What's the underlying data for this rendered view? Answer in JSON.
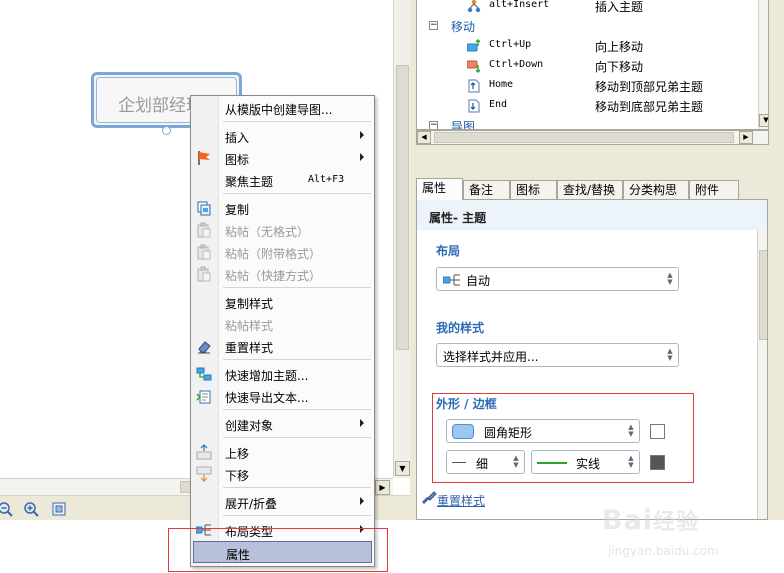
{
  "canvas": {
    "topic_text": "企划部经理"
  },
  "command_list": {
    "rows": [
      {
        "type": "command",
        "icon": "insert-topic-icon",
        "key": "alt+Insert",
        "desc": "插入主题"
      },
      {
        "type": "group",
        "toggle": "−",
        "name": "移动"
      },
      {
        "type": "command",
        "icon": "move-up-icon",
        "key": "Ctrl+Up",
        "desc": "向上移动"
      },
      {
        "type": "command",
        "icon": "move-down-icon",
        "key": "Ctrl+Down",
        "desc": "向下移动"
      },
      {
        "type": "command",
        "icon": "move-top-icon",
        "key": "Home",
        "desc": "移动到顶部兄弟主题"
      },
      {
        "type": "command",
        "icon": "move-bottom-icon",
        "key": "End",
        "desc": "移动到底部兄弟主题"
      },
      {
        "type": "group",
        "toggle": "−",
        "name": "导图"
      }
    ]
  },
  "tabs": [
    {
      "label": "属性",
      "active": true
    },
    {
      "label": "备注",
      "active": false
    },
    {
      "label": "图标",
      "active": false
    },
    {
      "label": "查找/替换",
      "active": false
    },
    {
      "label": "分类构思",
      "active": false
    },
    {
      "label": "附件",
      "active": false
    }
  ],
  "properties": {
    "title": "属性- 主题",
    "layout": {
      "section": "布局",
      "value": "自动"
    },
    "my_style": {
      "section": "我的样式",
      "value": "选择样式并应用..."
    },
    "shape": {
      "section": "外形 / 边框",
      "shape_value": "圆角矩形",
      "line_weight": "细",
      "line_style": "实线",
      "fill_color": "#ffffff",
      "line_color": "#555555"
    },
    "reset_link": "重置样式"
  },
  "context_menu": {
    "items": [
      {
        "label": "从模版中创建导图...",
        "icon": "",
        "disabled": false,
        "submenu": false,
        "shortcut": ""
      },
      {
        "sep": true
      },
      {
        "label": "插入",
        "icon": "",
        "disabled": false,
        "submenu": true,
        "shortcut": ""
      },
      {
        "label": "图标",
        "icon": "flag-icon",
        "disabled": false,
        "submenu": true,
        "shortcut": ""
      },
      {
        "label": "聚焦主题",
        "icon": "",
        "disabled": false,
        "submenu": false,
        "shortcut": "Alt+F3"
      },
      {
        "sep": true
      },
      {
        "label": "复制",
        "icon": "copy-icon",
        "disabled": false,
        "submenu": false,
        "shortcut": ""
      },
      {
        "label": "粘帖（无格式）",
        "icon": "paste-icon",
        "disabled": true,
        "submenu": false,
        "shortcut": ""
      },
      {
        "label": "粘帖（附带格式）",
        "icon": "paste-icon",
        "disabled": true,
        "submenu": false,
        "shortcut": ""
      },
      {
        "label": "粘帖（快捷方式）",
        "icon": "paste-icon",
        "disabled": true,
        "submenu": false,
        "shortcut": ""
      },
      {
        "sep": true
      },
      {
        "label": "复制样式",
        "icon": "",
        "disabled": false,
        "submenu": false,
        "shortcut": ""
      },
      {
        "label": "粘帖样式",
        "icon": "",
        "disabled": true,
        "submenu": false,
        "shortcut": ""
      },
      {
        "label": "重置样式",
        "icon": "eraser-icon",
        "disabled": false,
        "submenu": false,
        "shortcut": ""
      },
      {
        "sep": true
      },
      {
        "label": "快速增加主题...",
        "icon": "quick-add-icon",
        "disabled": false,
        "submenu": false,
        "shortcut": ""
      },
      {
        "label": "快速导出文本...",
        "icon": "export-text-icon",
        "disabled": false,
        "submenu": false,
        "shortcut": ""
      },
      {
        "sep": true
      },
      {
        "label": "创建对象",
        "icon": "",
        "disabled": false,
        "submenu": true,
        "shortcut": ""
      },
      {
        "sep": true
      },
      {
        "label": "上移",
        "icon": "move-up-icon",
        "disabled": false,
        "submenu": false,
        "shortcut": ""
      },
      {
        "label": "下移",
        "icon": "move-down-icon",
        "disabled": false,
        "submenu": false,
        "shortcut": ""
      },
      {
        "sep": true
      },
      {
        "label": "展开/折叠",
        "icon": "",
        "disabled": false,
        "submenu": true,
        "shortcut": ""
      },
      {
        "sep": true
      },
      {
        "label": "布局类型",
        "icon": "layout-icon",
        "disabled": false,
        "submenu": true,
        "shortcut": ""
      },
      {
        "label": "属性",
        "icon": "",
        "disabled": false,
        "submenu": false,
        "shortcut": "",
        "selected": true
      }
    ]
  },
  "watermark": {
    "main": "Bai",
    "main_tail": "经验",
    "sub": "jingyan.baidu.com"
  }
}
